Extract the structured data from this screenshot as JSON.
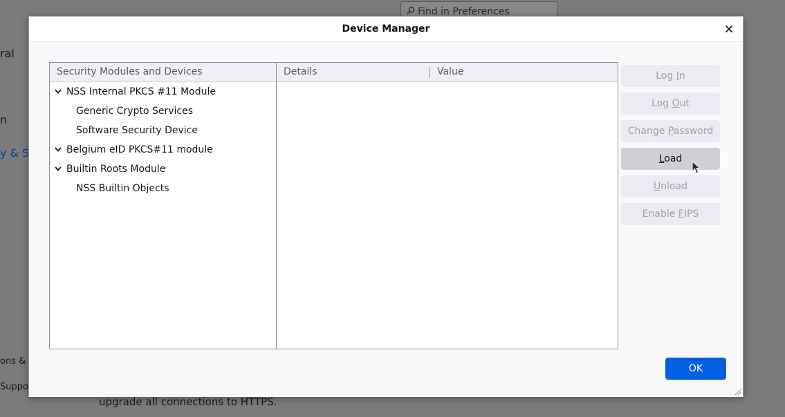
{
  "background": {
    "search_placeholder": "Find in Preferences",
    "side_fragments": [
      "ral",
      "n",
      "y & S",
      "ons &",
      "Suppo"
    ],
    "bottom_text": "upgrade all connections to HTTPS."
  },
  "dialog": {
    "title": "Device Manager",
    "close_icon": "close-icon",
    "tree": {
      "header": "Security Modules and Devices",
      "rows": [
        {
          "label": "NSS Internal PKCS #11 Module",
          "level": 0,
          "expanded": true
        },
        {
          "label": "Generic Crypto Services",
          "level": 1
        },
        {
          "label": "Software Security Device",
          "level": 1
        },
        {
          "label": "Belgium eID PKCS#11 module",
          "level": 0,
          "expanded": true
        },
        {
          "label": "Builtin Roots Module",
          "level": 0,
          "expanded": true
        },
        {
          "label": "NSS Builtin Objects",
          "level": 1
        }
      ]
    },
    "details": {
      "col_details": "Details",
      "col_value": "Value"
    },
    "buttons": {
      "log_in": {
        "pre": "Log ",
        "key": "I",
        "post": "n",
        "enabled": false
      },
      "log_out": {
        "pre": "Log ",
        "key": "O",
        "post": "ut",
        "enabled": false
      },
      "change_password": {
        "pre": "Change ",
        "key": "P",
        "post": "assword",
        "enabled": false
      },
      "load": {
        "pre": "",
        "key": "L",
        "post": "oad",
        "enabled": true
      },
      "unload": {
        "pre": "",
        "key": "U",
        "post": "nload",
        "enabled": false
      },
      "enable_fips": {
        "pre": "Enable ",
        "key": "F",
        "post": "IPS",
        "enabled": false
      }
    },
    "ok_label": "OK"
  },
  "colors": {
    "accent": "#0061e0",
    "overlay": "#7b7b7e"
  }
}
